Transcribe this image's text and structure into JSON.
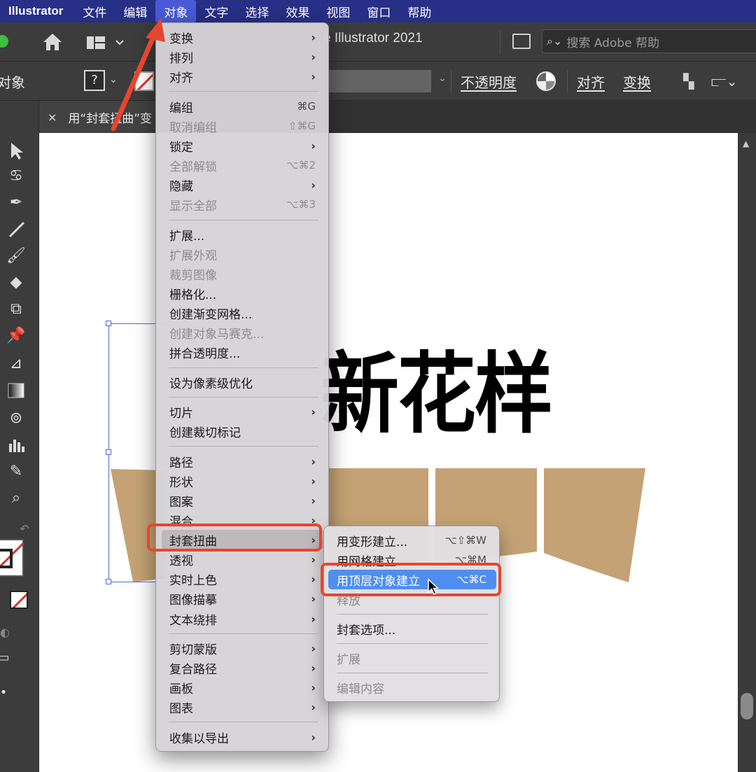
{
  "menubar": {
    "app": "Illustrator",
    "items": [
      "文件",
      "编辑",
      "对象",
      "文字",
      "选择",
      "效果",
      "视图",
      "窗口",
      "帮助"
    ],
    "active_index": 2
  },
  "appbar": {
    "title": "e Illustrator 2021",
    "search_placeholder": "搜索 Adobe 帮助"
  },
  "control_bar": {
    "selection_label": "对象",
    "question": "?",
    "opacity_label": "不透明度",
    "align_label": "对齐",
    "transform_label": "变换"
  },
  "tab": {
    "close": "×",
    "title": "用“封套扭曲”变"
  },
  "canvas": {
    "headline": "新花样",
    "shape_color": "#c4a275"
  },
  "object_menu": {
    "items": [
      {
        "label": "变换",
        "arrow": "›"
      },
      {
        "label": "排列",
        "arrow": "›"
      },
      {
        "label": "对齐",
        "arrow": "›"
      },
      {
        "label": "编组",
        "shortcut": "⌘G"
      },
      {
        "label": "取消编组",
        "shortcut": "⇧⌘G"
      },
      {
        "label": "锁定",
        "arrow": "›"
      },
      {
        "label": "全部解锁",
        "shortcut": "⌥⌘2"
      },
      {
        "label": "隐藏",
        "arrow": "›"
      },
      {
        "label": "显示全部",
        "shortcut": "⌥⌘3"
      },
      {
        "label": "扩展..."
      },
      {
        "label": "扩展外观"
      },
      {
        "label": "裁剪图像"
      },
      {
        "label": "栅格化..."
      },
      {
        "label": "创建渐变网格..."
      },
      {
        "label": "创建对象马赛克..."
      },
      {
        "label": "拼合透明度..."
      },
      {
        "label": "设为像素级优化"
      },
      {
        "label": "切片",
        "arrow": "›"
      },
      {
        "label": "创建裁切标记"
      },
      {
        "label": "路径",
        "arrow": "›"
      },
      {
        "label": "形状",
        "arrow": "›"
      },
      {
        "label": "图案",
        "arrow": "›"
      },
      {
        "label": "混合",
        "arrow": "›"
      },
      {
        "label": "封套扭曲",
        "arrow": "›"
      },
      {
        "label": "透视",
        "arrow": "›"
      },
      {
        "label": "实时上色",
        "arrow": "›"
      },
      {
        "label": "图像描摹",
        "arrow": "›"
      },
      {
        "label": "文本绕排",
        "arrow": "›"
      },
      {
        "label": "剪切蒙版",
        "arrow": "›"
      },
      {
        "label": "复合路径",
        "arrow": "›"
      },
      {
        "label": "画板",
        "arrow": "›"
      },
      {
        "label": "图表",
        "arrow": "›"
      },
      {
        "label": "收集以导出",
        "arrow": "›"
      }
    ]
  },
  "envelope_submenu": {
    "items": [
      {
        "label": "用变形建立...",
        "shortcut": "⌥⇧⌘W"
      },
      {
        "label": "用网格建立...",
        "shortcut": "⌥⌘M"
      },
      {
        "label": "用顶层对象建立",
        "shortcut": "⌥⌘C"
      },
      {
        "label": "释放"
      },
      {
        "label": "封套选项..."
      },
      {
        "label": "扩展"
      },
      {
        "label": "编辑内容"
      }
    ]
  }
}
